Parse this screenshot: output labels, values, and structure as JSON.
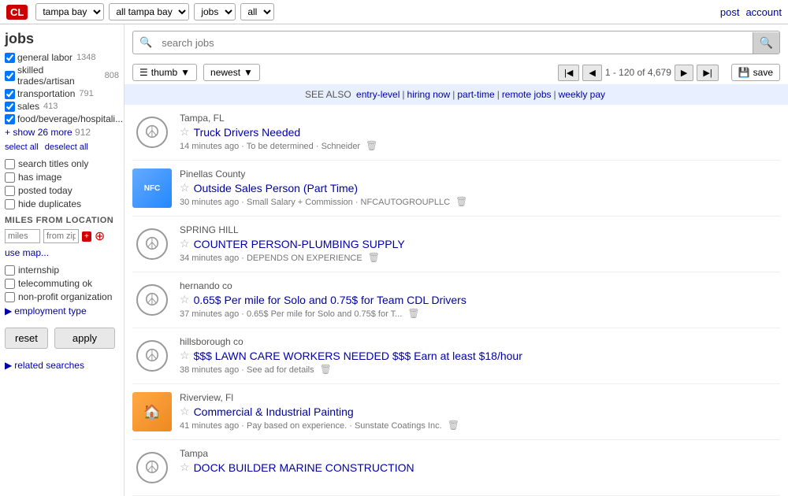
{
  "topbar": {
    "logo": "CL",
    "dropdowns": {
      "location": "tampa bay",
      "area": "all tampa bay",
      "category": "jobs",
      "subcategory": "all"
    },
    "post_link": "post",
    "account_link": "account"
  },
  "sidebar": {
    "title": "jobs",
    "categories": [
      {
        "label": "general labor",
        "count": "1348",
        "checked": true
      },
      {
        "label": "skilled trades/artisan",
        "count": "808",
        "checked": true
      },
      {
        "label": "transportation",
        "count": "791",
        "checked": true
      },
      {
        "label": "sales",
        "count": "413",
        "checked": true
      },
      {
        "label": "food/beverage/hospitali...",
        "count": "",
        "checked": true
      }
    ],
    "show_more": "+ show 26 more",
    "show_more_count": "912",
    "select_all": "select all",
    "deselect_all": "deselect all",
    "filters": [
      {
        "label": "search titles only",
        "checked": false
      },
      {
        "label": "has image",
        "checked": false
      },
      {
        "label": "posted today",
        "checked": false
      },
      {
        "label": "hide duplicates",
        "checked": false
      }
    ],
    "miles_label": "MILES FROM LOCATION",
    "miles_placeholder": "miles",
    "zip_placeholder": "from zip",
    "use_map": "use map...",
    "extra_filters": [
      {
        "label": "internship",
        "checked": false
      },
      {
        "label": "telecommuting ok",
        "checked": false
      },
      {
        "label": "non-profit organization",
        "checked": false
      }
    ],
    "employment_type": "employment type",
    "reset_label": "reset",
    "apply_label": "apply",
    "related_searches": "related searches"
  },
  "search": {
    "placeholder": "search jobs"
  },
  "toolbar": {
    "view_label": "thumb",
    "sort_label": "newest",
    "page_info": "1 - 120 of 4,679",
    "save_label": "save"
  },
  "see_also": {
    "prefix": "SEE ALSO",
    "links": [
      "entry-level",
      "hiring now",
      "part-time",
      "remote jobs",
      "weekly pay"
    ]
  },
  "jobs": [
    {
      "location": "Tampa, FL",
      "title": "Truck Drivers Needed",
      "meta": "14 minutes ago · To be determined · Schneider",
      "has_thumb": false,
      "thumb_type": ""
    },
    {
      "location": "Pinellas County",
      "title": "Outside Sales Person (Part Time)",
      "meta": "30 minutes ago · Small Salary + Commission · NFCAUTOGROUPLLC",
      "has_thumb": true,
      "thumb_type": "blue"
    },
    {
      "location": "SPRING HILL",
      "title": "COUNTER PERSON-PLUMBING SUPPLY",
      "meta": "34 minutes ago · DEPENDS ON EXPERIENCE",
      "has_thumb": false,
      "thumb_type": ""
    },
    {
      "location": "hernando co",
      "title": "0.65$ Per mile for Solo and 0.75$ for Team CDL Drivers",
      "meta": "37 minutes ago · 0.65$ Per mile for Solo and 0.75$ for T...",
      "has_thumb": false,
      "thumb_type": ""
    },
    {
      "location": "hillsborough co",
      "title": "$$$ LAWN CARE WORKERS NEEDED $$$ Earn at least $18/hour",
      "meta": "38 minutes ago · See ad for details",
      "has_thumb": false,
      "thumb_type": ""
    },
    {
      "location": "Riverview, Fl",
      "title": "Commercial & Industrial Painting",
      "meta": "41 minutes ago · Pay based on experience. · Sunstate Coatings Inc.",
      "has_thumb": true,
      "thumb_type": "green"
    },
    {
      "location": "Tampa",
      "title": "DOCK BUILDER MARINE CONSTRUCTION",
      "meta": "",
      "has_thumb": false,
      "thumb_type": ""
    }
  ]
}
